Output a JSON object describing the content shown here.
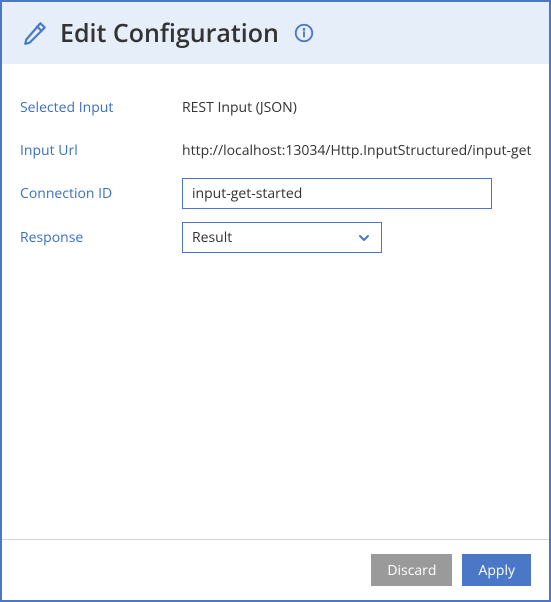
{
  "header": {
    "title": "Edit Configuration"
  },
  "form": {
    "selected_input": {
      "label": "Selected Input",
      "value": "REST Input (JSON)"
    },
    "input_url": {
      "label": "Input Url",
      "value": "http://localhost:13034/Http.InputStructured/input-get"
    },
    "connection_id": {
      "label": "Connection ID",
      "value": "input-get-started"
    },
    "response": {
      "label": "Response",
      "value": "Result"
    }
  },
  "footer": {
    "discard_label": "Discard",
    "apply_label": "Apply"
  }
}
